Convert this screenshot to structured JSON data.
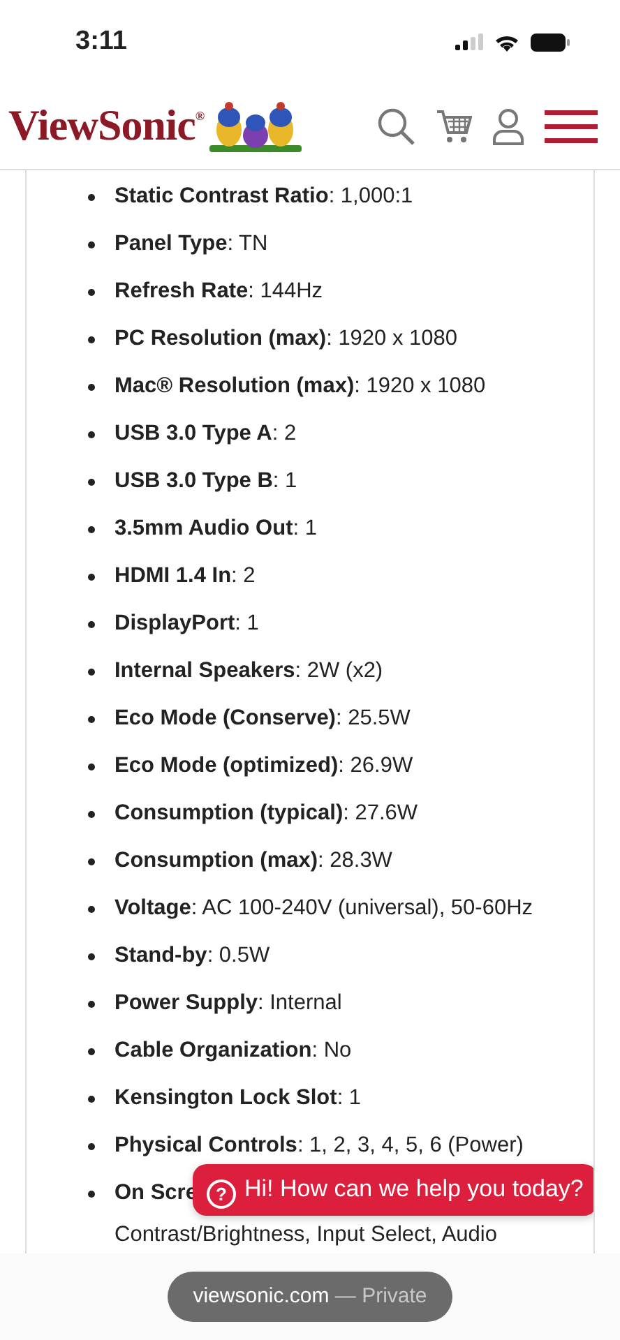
{
  "status_bar": {
    "time": "3:11"
  },
  "header": {
    "logo": "ViewSonic$^{®}$"
  },
  "specs": [
    {
      "label": "Static Contrast Ratio",
      "value": ": 1,000:1"
    },
    {
      "label": "Panel Type",
      "value": ": TN"
    },
    {
      "label": "Refresh Rate",
      "value": ": 144Hz"
    },
    {
      "label": "PC Resolution (max)",
      "value": ": 1920 x 1080"
    },
    {
      "label": "Mac® Resolution (max)",
      "value": ": 1920 x 1080"
    },
    {
      "label": "USB 3.0 Type A",
      "value": ": 2"
    },
    {
      "label": "USB 3.0 Type B",
      "value": ": 1"
    },
    {
      "label": "3.5mm Audio Out",
      "value": ": 1"
    },
    {
      "label": "HDMI 1.4 In",
      "value": ": 2"
    },
    {
      "label": "DisplayPort",
      "value": ": 1"
    },
    {
      "label": "Internal Speakers",
      "value": ": 2W (x2)"
    },
    {
      "label": "Eco Mode (Conserve)",
      "value": ": 25.5W"
    },
    {
      "label": "Eco Mode (optimized)",
      "value": ": 26.9W"
    },
    {
      "label": "Consumption (typical)",
      "value": ": 27.6W"
    },
    {
      "label": "Consumption (max)",
      "value": ": 28.3W"
    },
    {
      "label": "Voltage",
      "value": ": AC 100-240V (universal), 50-60Hz"
    },
    {
      "label": "Stand-by",
      "value": ": 0.5W"
    },
    {
      "label": "Power Supply",
      "value": ": Internal"
    },
    {
      "label": "Cable Organization",
      "value": ": No"
    },
    {
      "label": "Kensington Lock Slot",
      "value": ": 1"
    },
    {
      "label": "Physical Controls",
      "value": ": 1, 2, 3, 4, 5, 6 (Power)"
    },
    {
      "label": "On Scre",
      "value": "Contrast/Brightness, Input Select, Audio",
      "kind": "wrapped"
    }
  ],
  "chat_bubble": {
    "text": "Hi! How can we help you today?",
    "icon": "?"
  },
  "address_bar": {
    "domain": "viewsonic.com",
    "mode": "— Private"
  }
}
